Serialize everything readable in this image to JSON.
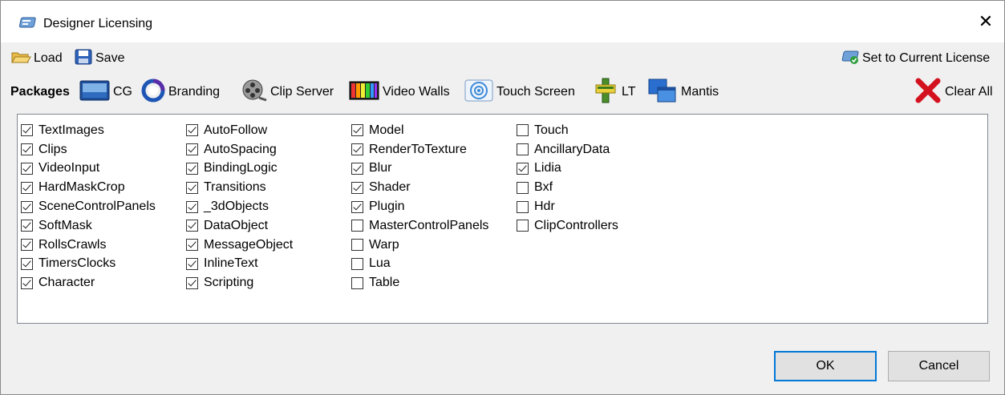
{
  "window": {
    "title": "Designer Licensing"
  },
  "toolbar": {
    "load_label": "Load",
    "save_label": "Save",
    "set_current_label": "Set to Current License"
  },
  "packages": {
    "heading": "Packages",
    "items": [
      {
        "label": "CG",
        "icon": "cg-monitor-icon"
      },
      {
        "label": "Branding",
        "icon": "branding-swirl-icon"
      },
      {
        "label": "Clip Server",
        "icon": "film-reel-icon"
      },
      {
        "label": "Video Walls",
        "icon": "video-wall-icon"
      },
      {
        "label": "Touch Screen",
        "icon": "touch-target-icon"
      },
      {
        "label": "LT",
        "icon": "lt-icon"
      },
      {
        "label": "Mantis",
        "icon": "mantis-windows-icon"
      }
    ],
    "clear_all_label": "Clear All"
  },
  "features": {
    "columns": [
      [
        {
          "label": "TextImages",
          "checked": true
        },
        {
          "label": "Clips",
          "checked": true
        },
        {
          "label": "VideoInput",
          "checked": true
        },
        {
          "label": "HardMaskCrop",
          "checked": true
        },
        {
          "label": "SceneControlPanels",
          "checked": true
        },
        {
          "label": "SoftMask",
          "checked": true
        },
        {
          "label": "RollsCrawls",
          "checked": true
        },
        {
          "label": "TimersClocks",
          "checked": true
        },
        {
          "label": "Character",
          "checked": true
        }
      ],
      [
        {
          "label": "AutoFollow",
          "checked": true
        },
        {
          "label": "AutoSpacing",
          "checked": true
        },
        {
          "label": "BindingLogic",
          "checked": true
        },
        {
          "label": "Transitions",
          "checked": true
        },
        {
          "label": "_3dObjects",
          "checked": true
        },
        {
          "label": "DataObject",
          "checked": true
        },
        {
          "label": "MessageObject",
          "checked": true
        },
        {
          "label": "InlineText",
          "checked": true
        },
        {
          "label": "Scripting",
          "checked": true
        }
      ],
      [
        {
          "label": "Model",
          "checked": true
        },
        {
          "label": "RenderToTexture",
          "checked": true
        },
        {
          "label": "Blur",
          "checked": true
        },
        {
          "label": "Shader",
          "checked": true
        },
        {
          "label": "Plugin",
          "checked": true
        },
        {
          "label": "MasterControlPanels",
          "checked": false
        },
        {
          "label": "Warp",
          "checked": false
        },
        {
          "label": "Lua",
          "checked": false
        },
        {
          "label": "Table",
          "checked": false
        }
      ],
      [
        {
          "label": "Touch",
          "checked": false
        },
        {
          "label": "AncillaryData",
          "checked": false
        },
        {
          "label": "Lidia",
          "checked": true
        },
        {
          "label": "Bxf",
          "checked": false
        },
        {
          "label": "Hdr",
          "checked": false
        },
        {
          "label": "ClipControllers",
          "checked": false
        }
      ]
    ]
  },
  "buttons": {
    "ok_label": "OK",
    "cancel_label": "Cancel"
  },
  "colors": {
    "ok_border": "#0078d7",
    "clear_all_x": "#d4121f",
    "window_bg": "#f0f0f0"
  }
}
